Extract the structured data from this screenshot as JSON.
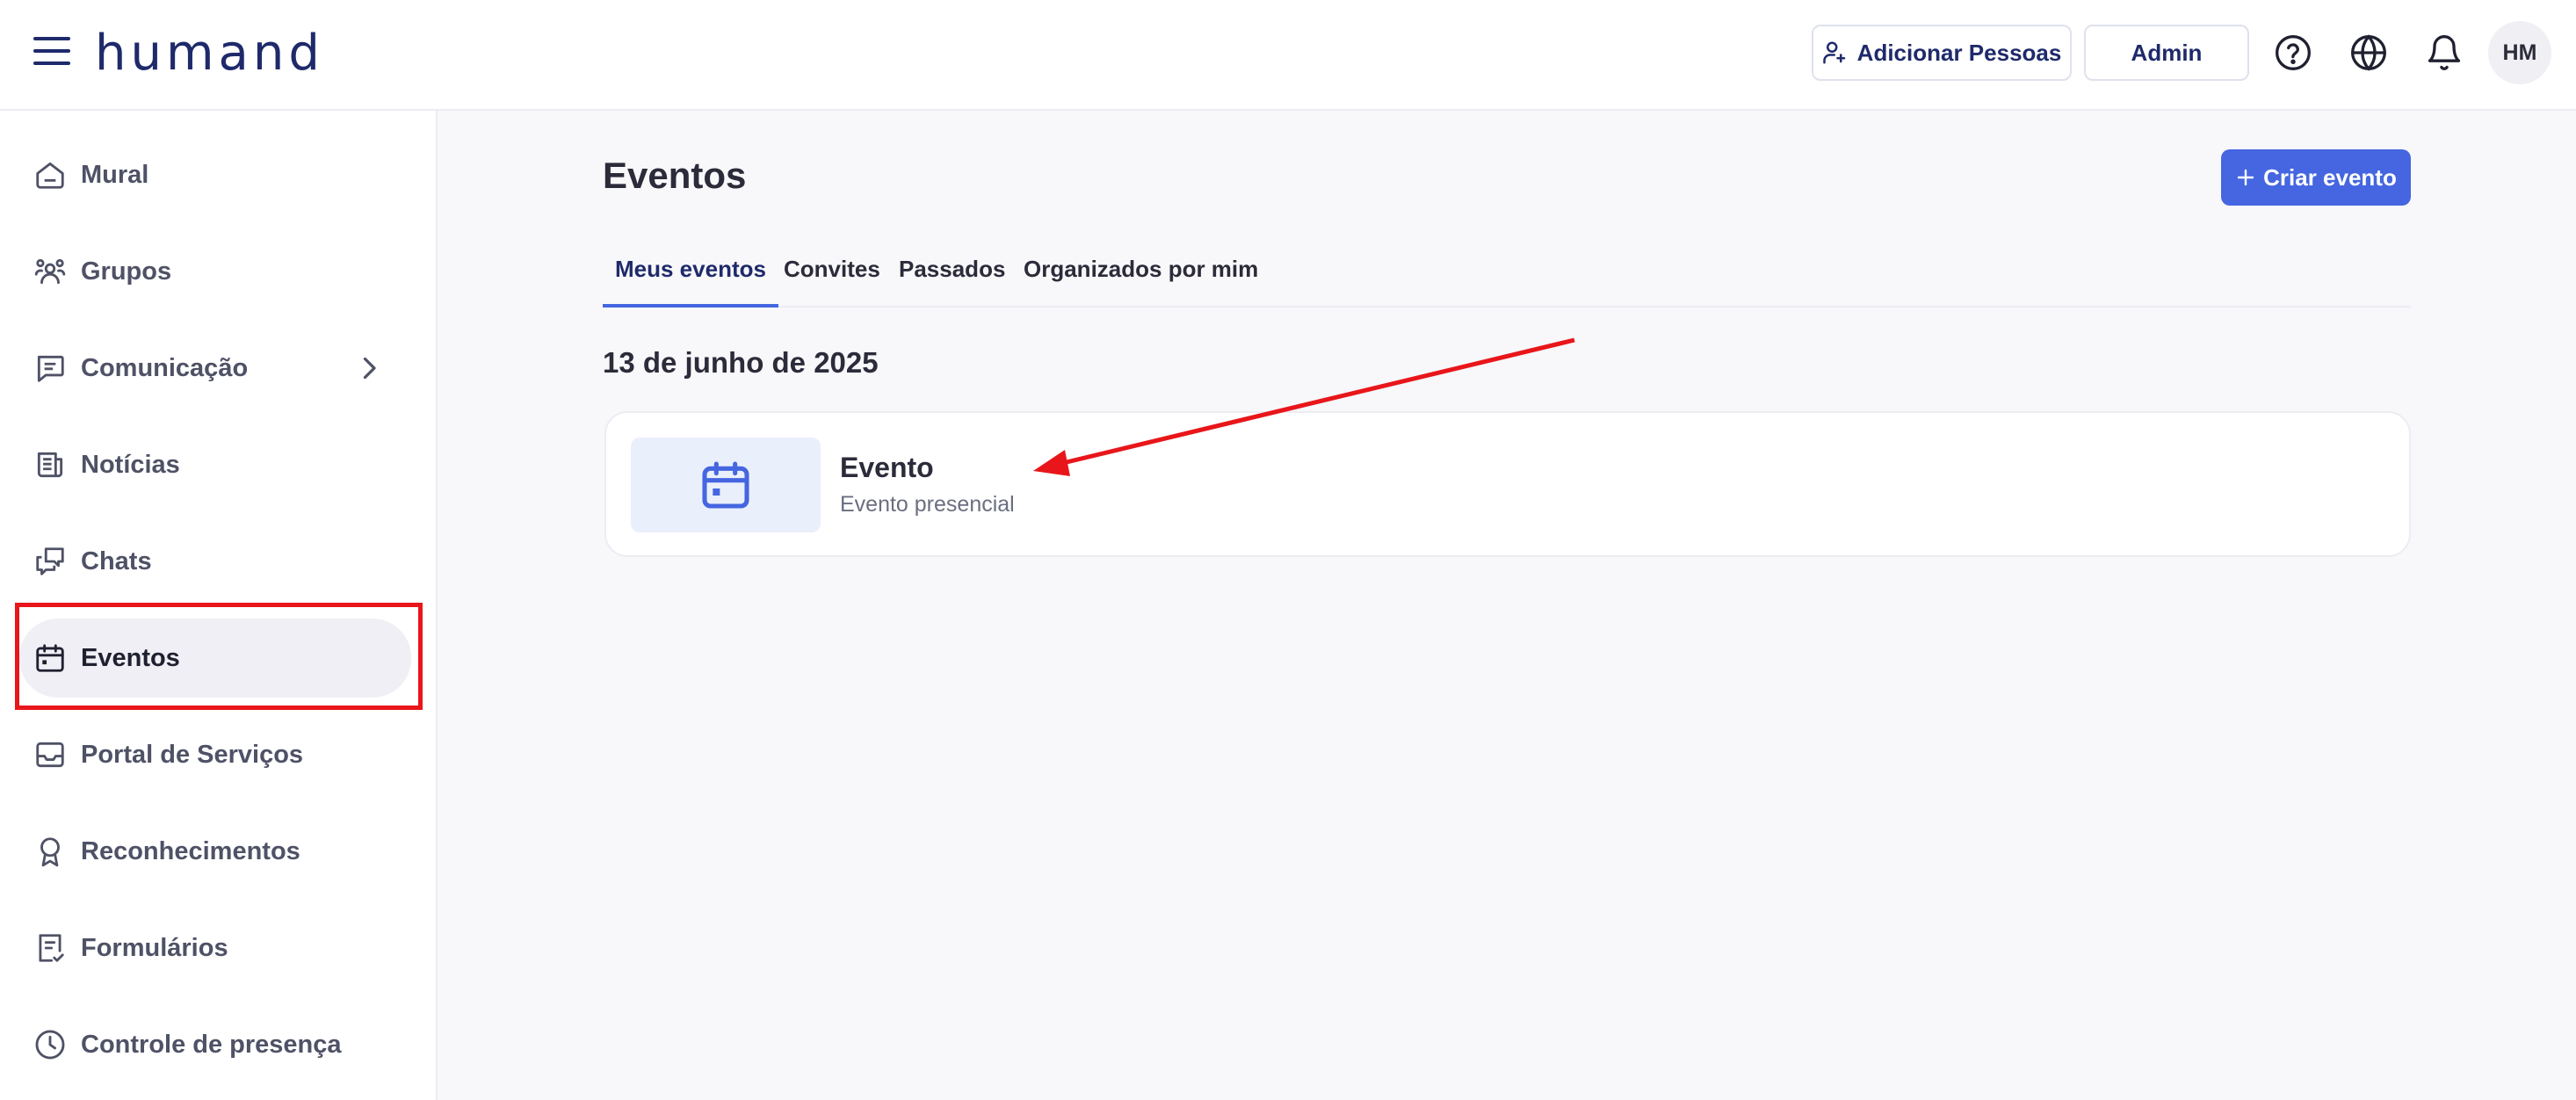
{
  "app": {
    "logo_text": "humand"
  },
  "header": {
    "add_people_label": "Adicionar Pessoas",
    "admin_label": "Admin",
    "avatar_initials": "HM"
  },
  "sidebar": {
    "items": [
      {
        "label": "Mural",
        "icon": "home-icon"
      },
      {
        "label": "Grupos",
        "icon": "groups-icon"
      },
      {
        "label": "Comunicação",
        "icon": "message-icon"
      },
      {
        "label": "Notícias",
        "icon": "news-icon"
      },
      {
        "label": "Chats",
        "icon": "chats-icon"
      },
      {
        "label": "Eventos",
        "icon": "calendar-icon"
      },
      {
        "label": "Portal de Serviços",
        "icon": "inbox-icon"
      },
      {
        "label": "Reconhecimentos",
        "icon": "award-icon"
      },
      {
        "label": "Formulários",
        "icon": "form-icon"
      },
      {
        "label": "Controle de presença",
        "icon": "clock-icon"
      }
    ],
    "active_item": "Eventos"
  },
  "main": {
    "title": "Eventos",
    "create_button_label": "Criar evento",
    "tabs": [
      {
        "label": "Meus eventos",
        "active": true
      },
      {
        "label": "Convites",
        "active": false
      },
      {
        "label": "Passados",
        "active": false
      },
      {
        "label": "Organizados por mim",
        "active": false
      }
    ],
    "date_heading": "13 de junho de 2025",
    "events": [
      {
        "title": "Evento",
        "subtitle": "Evento presencial",
        "icon": "calendar-icon"
      }
    ]
  },
  "colors": {
    "brand_navy": "#1f2a6b",
    "accent_blue": "#4566e0",
    "annotation_red": "#e8161a"
  }
}
